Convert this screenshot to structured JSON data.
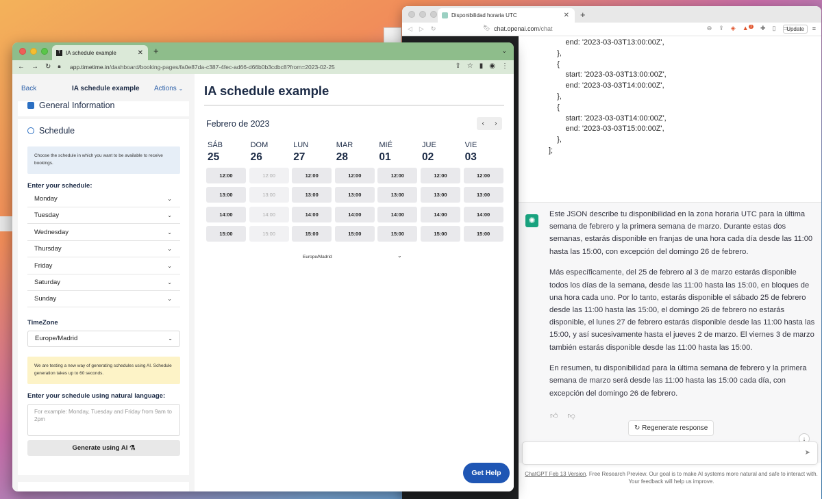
{
  "right_window": {
    "tab_title": "Disponibilidad horaria UTC",
    "url_domain": "chat.openai.com",
    "url_path": "/chat",
    "update_label": "Update",
    "badge_count": "1",
    "code_lines": [
      "        end: '2023-03-03T13:00:00Z',",
      "    },",
      "    {",
      "        start: '2023-03-03T13:00:00Z',",
      "        end: '2023-03-03T14:00:00Z',",
      "    },",
      "    {",
      "        start: '2023-03-03T14:00:00Z',",
      "        end: '2023-03-03T15:00:00Z',",
      "    },",
      "];"
    ],
    "response_paragraphs": [
      "Este JSON describe tu disponibilidad en la zona horaria UTC para la última semana de febrero y la primera semana de marzo. Durante estas dos semanas, estarás disponible en franjas de una hora cada día desde las 11:00 hasta las 15:00, con excepción del domingo 26 de febrero.",
      "Más específicamente, del 25 de febrero al 3 de marzo estarás disponible todos los días de la semana, desde las 11:00 hasta las 15:00, en bloques de una hora cada uno. Por lo tanto, estarás disponible el sábado 25 de febrero desde las 11:00 hasta las 15:00, el domingo 26 de febrero no estarás disponible, el lunes 27 de febrero estarás disponible desde las 11:00 hasta las 15:00, y así sucesivamente hasta el jueves 2 de marzo. El viernes 3 de marzo también estarás disponible desde las 11:00 hasta las 15:00.",
      "En resumen, tu disponibilidad para la última semana de febrero y la primera semana de marzo será desde las 11:00 hasta las 15:00 cada día, con excepción del domingo 26 de febrero."
    ],
    "regenerate_label": "Regenerate response",
    "footer_link": "ChatGPT Feb 13 Version",
    "footer_text": ". Free Research Preview. Our goal is to make AI systems more natural and safe to interact with. Your feedback will help us improve."
  },
  "left_window": {
    "tab_title": "IA schedule example",
    "url_domain": "app.timetime.in",
    "url_path": "/dashboard/booking-pages/fa0e87da-c387-4fec-ad66-d66b0b3cdbc8?from=2023-02-25",
    "sidebar": {
      "back_label": "Back",
      "title": "IA schedule example",
      "actions_label": "Actions",
      "general_info_label": "General Information",
      "schedule_label": "Schedule",
      "schedule_info": "Choose the schedule in which you want to be available to receive bookings.",
      "enter_schedule_label": "Enter your schedule:",
      "days": [
        "Monday",
        "Tuesday",
        "Wednesday",
        "Thursday",
        "Friday",
        "Saturday",
        "Sunday"
      ],
      "timezone_label": "TimeZone",
      "timezone_value": "Europe/Madrid",
      "ai_info": "We are testing a new way of generating schedules using AI. Schedule generation takes up to 60 seconds.",
      "natural_language_label": "Enter your schedule using natural language:",
      "natural_language_placeholder": "For example: Monday, Tuesday and Friday from 9am to 2pm",
      "generate_label": "Generate using AI"
    },
    "main": {
      "title": "IA schedule example",
      "month_label": "Febrero de 2023",
      "days": [
        {
          "dow": "SÁB",
          "num": "25",
          "available": true
        },
        {
          "dow": "DOM",
          "num": "26",
          "available": false
        },
        {
          "dow": "LUN",
          "num": "27",
          "available": true
        },
        {
          "dow": "MAR",
          "num": "28",
          "available": true
        },
        {
          "dow": "MIÉ",
          "num": "01",
          "available": true
        },
        {
          "dow": "JUE",
          "num": "02",
          "available": true
        },
        {
          "dow": "VIE",
          "num": "03",
          "available": true
        }
      ],
      "slots": [
        "12:00",
        "13:00",
        "14:00",
        "15:00"
      ],
      "timezone": "Europe/Madrid",
      "help_label": "Get Help"
    }
  }
}
